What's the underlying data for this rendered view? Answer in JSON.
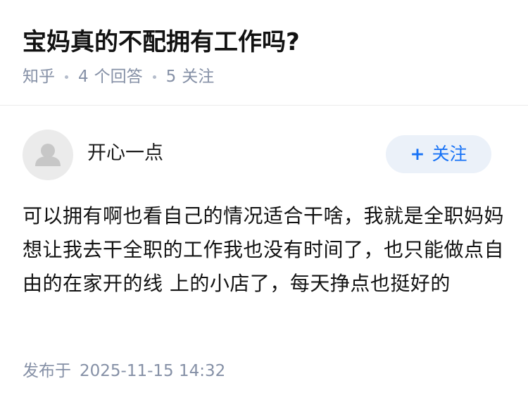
{
  "question": {
    "title": "宝妈真的不配拥有工作吗?",
    "source": "知乎",
    "answer_count": "4",
    "answer_label": "个回答",
    "follow_count": "5",
    "follow_label": "关注"
  },
  "author": {
    "name": "开心一点",
    "avatar_icon": "default-user-avatar-icon",
    "follow_button_plus": "+",
    "follow_button_label": "关注"
  },
  "answer": {
    "content": "可以拥有啊也看自己的情况适合干啥，我就是全职妈妈想让我去干全职的工作我也没有时间了，也只能做点自由的在家开的线 上的小店了，每天挣点也挺好的"
  },
  "footer": {
    "publish_label": "发布于",
    "publish_time": "2025-11-15 14:32"
  },
  "colors": {
    "accent": "#1772f6",
    "follow_bg": "#ebf1f9",
    "meta_text": "#8590a6",
    "title_text": "#121212"
  }
}
